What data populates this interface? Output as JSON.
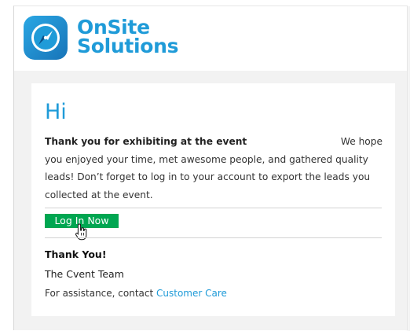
{
  "brand": {
    "name_line1": "OnSite",
    "name_line2": "Solutions",
    "accent_color": "#1f9bd8",
    "logo_icon": "compass-icon"
  },
  "email": {
    "greeting": "Hi",
    "lead_text": "Thank you for exhibiting at the event",
    "lead_right": "We hope",
    "body_text": "you enjoyed your time, met awesome people, and gathered quality leads! Don’t forget to log in to your account to export the leads you collected at the event.",
    "login_button": "Log In Now",
    "login_button_color": "#00a651",
    "signoff": "Thank You!",
    "team": "The Cvent Team",
    "assist_prefix": "For assistance, contact ",
    "assist_link": "Customer Care"
  }
}
